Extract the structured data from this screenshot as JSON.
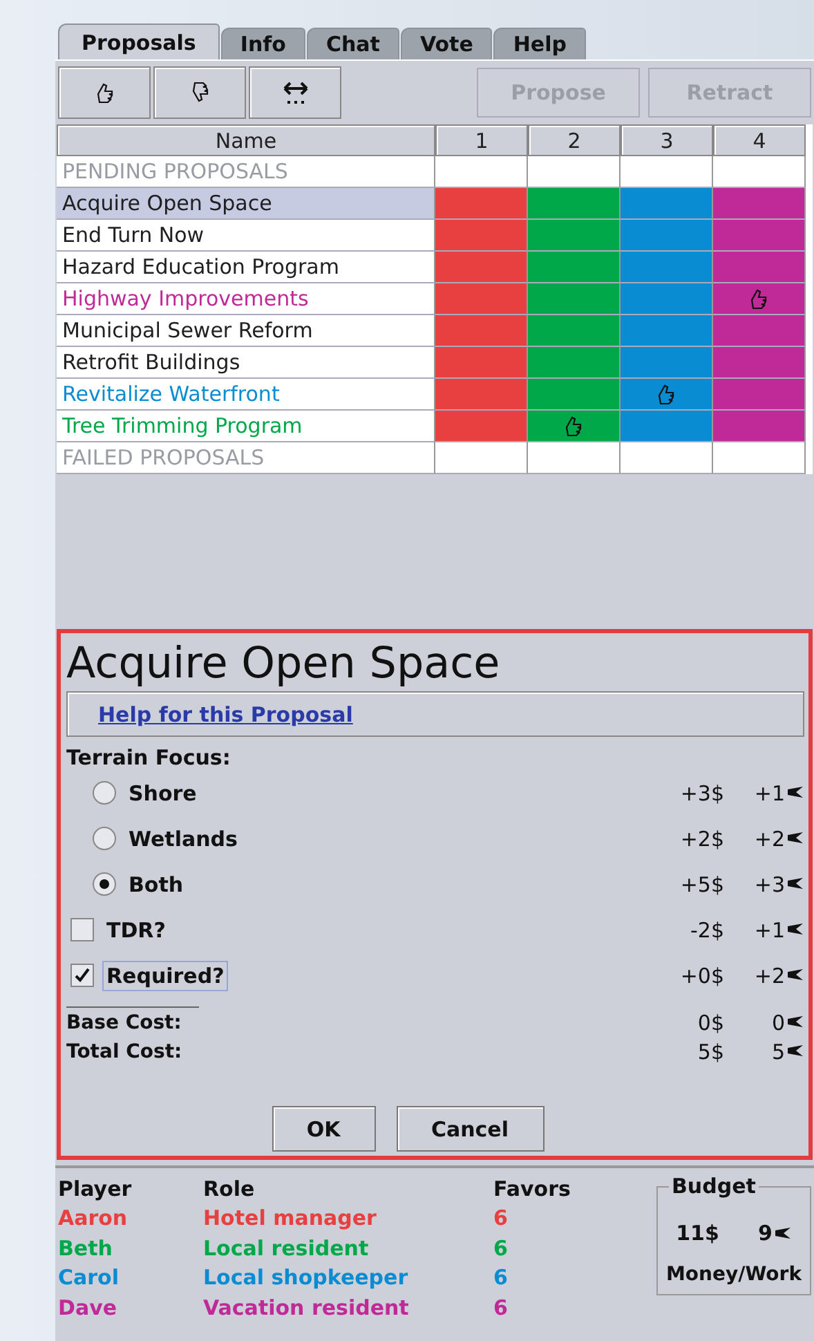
{
  "tabs": [
    {
      "label": "Proposals",
      "selected": true
    },
    {
      "label": "Info",
      "selected": false
    },
    {
      "label": "Chat",
      "selected": false
    },
    {
      "label": "Vote",
      "selected": false
    },
    {
      "label": "Help",
      "selected": false
    }
  ],
  "toolbar": {
    "icon_buttons": [
      {
        "kind": "thumbs-up"
      },
      {
        "kind": "thumbs-down"
      },
      {
        "kind": "swap"
      }
    ],
    "buttons": [
      {
        "label": "Propose",
        "disabled": true
      },
      {
        "label": "Retract",
        "disabled": true
      }
    ]
  },
  "table": {
    "columns": [
      {
        "label": "Name"
      },
      {
        "label": "1",
        "color": "#e84040"
      },
      {
        "label": "2",
        "color": "#00a84a"
      },
      {
        "label": "3",
        "color": "#0a8cd2"
      },
      {
        "label": "4",
        "color": "#c02a98"
      }
    ],
    "rows": [
      {
        "kind": "header",
        "name": "PENDING PROPOSALS"
      },
      {
        "kind": "proposal",
        "name": "Acquire Open Space",
        "color": "#202020",
        "selected": true,
        "votes": [
          false,
          false,
          false,
          false
        ]
      },
      {
        "kind": "proposal",
        "name": "End Turn Now",
        "color": "#202020",
        "selected": false,
        "votes": [
          false,
          false,
          false,
          false
        ]
      },
      {
        "kind": "proposal",
        "name": "Hazard Education Program",
        "color": "#202020",
        "selected": false,
        "votes": [
          false,
          false,
          false,
          false
        ]
      },
      {
        "kind": "proposal",
        "name": "Highway Improvements",
        "color": "#c02a98",
        "selected": false,
        "votes": [
          false,
          false,
          false,
          true
        ]
      },
      {
        "kind": "proposal",
        "name": "Municipal Sewer Reform",
        "color": "#202020",
        "selected": false,
        "votes": [
          false,
          false,
          false,
          false
        ]
      },
      {
        "kind": "proposal",
        "name": "Retrofit Buildings",
        "color": "#202020",
        "selected": false,
        "votes": [
          false,
          false,
          false,
          false
        ]
      },
      {
        "kind": "proposal",
        "name": "Revitalize Waterfront",
        "color": "#0a8cd2",
        "selected": false,
        "votes": [
          false,
          false,
          true,
          false
        ]
      },
      {
        "kind": "proposal",
        "name": "Tree Trimming Program",
        "color": "#00a84a",
        "selected": false,
        "votes": [
          false,
          true,
          false,
          false
        ]
      },
      {
        "kind": "header",
        "name": "FAILED PROPOSALS"
      }
    ]
  },
  "detail": {
    "title": "Acquire Open Space",
    "help_link": "Help for this Proposal",
    "section_label": "Terrain Focus:",
    "options": [
      {
        "kind": "radio",
        "label": "Shore",
        "selected": false,
        "money": "+3$",
        "work": "+1"
      },
      {
        "kind": "radio",
        "label": "Wetlands",
        "selected": false,
        "money": "+2$",
        "work": "+2"
      },
      {
        "kind": "radio",
        "label": "Both",
        "selected": true,
        "money": "+5$",
        "work": "+3"
      },
      {
        "kind": "checkbox",
        "label": "TDR?",
        "checked": false,
        "focused": false,
        "money": "-2$",
        "work": "+1"
      },
      {
        "kind": "checkbox",
        "label": "Required?",
        "checked": true,
        "focused": true,
        "money": "+0$",
        "work": "+2"
      }
    ],
    "costs": [
      {
        "label": "Base Cost:",
        "money": "0$",
        "work": "0"
      },
      {
        "label": "Total Cost:",
        "money": "5$",
        "work": "5"
      }
    ],
    "buttons": [
      "OK",
      "Cancel"
    ]
  },
  "players": {
    "columns": [
      "Player",
      "Role",
      "Favors"
    ],
    "rows": [
      {
        "name": "Aaron",
        "role": "Hotel manager",
        "favors": "6",
        "color": "#e84040"
      },
      {
        "name": "Beth",
        "role": "Local resident",
        "favors": "6",
        "color": "#00a84a"
      },
      {
        "name": "Carol",
        "role": "Local shopkeeper",
        "favors": "6",
        "color": "#0a8cd2"
      },
      {
        "name": "Dave",
        "role": "Vacation resident",
        "favors": "6",
        "color": "#c02a98"
      }
    ]
  },
  "budget": {
    "title": "Budget",
    "money": "11$",
    "work": "9",
    "caption": "Money/Work"
  }
}
